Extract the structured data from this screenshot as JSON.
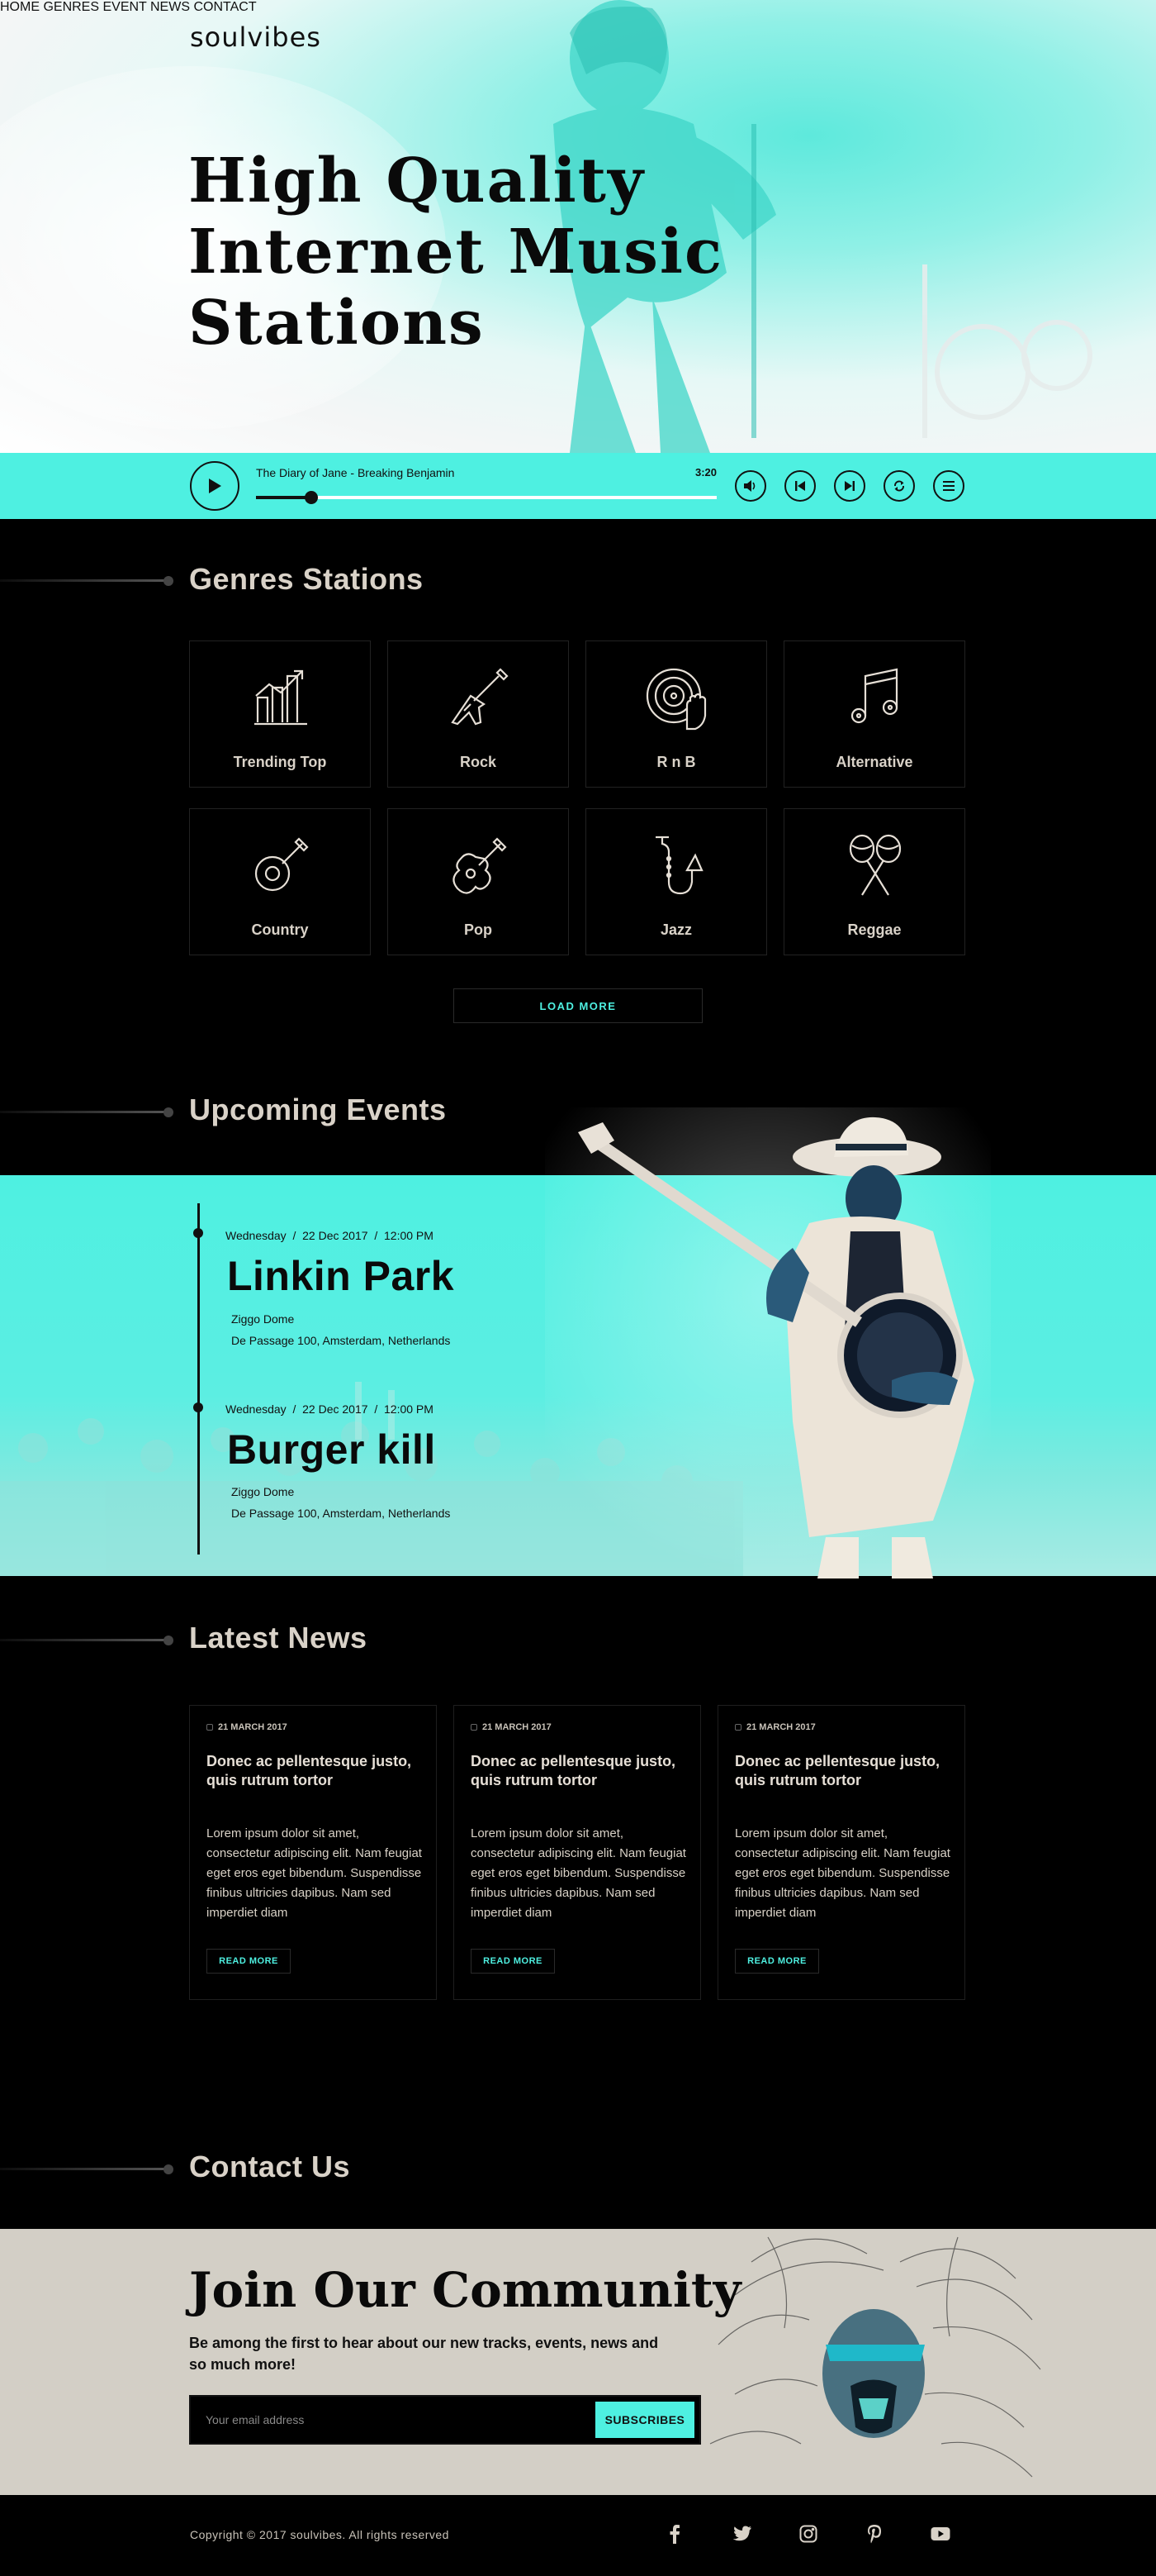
{
  "brand": {
    "logo": "soulvibes"
  },
  "nav": [
    {
      "label": "HOME"
    },
    {
      "label": "GENRES"
    },
    {
      "label": "EVENT"
    },
    {
      "label": "NEWS"
    },
    {
      "label": "CONTACT"
    }
  ],
  "hero": {
    "title_lines": [
      "High Quality",
      "Internet Music",
      "Stations"
    ]
  },
  "player": {
    "track": "The Diary of Jane - Breaking Benjamin",
    "time": "3:20",
    "progress": 0.12,
    "controls": [
      "volume-icon",
      "previous-icon",
      "next-icon",
      "repeat-icon",
      "playlist-icon"
    ],
    "accent": "#4ef0e1"
  },
  "genres": {
    "title": "Genres Stations",
    "items": [
      {
        "label": "Trending Top",
        "icon": "chart-icon"
      },
      {
        "label": "Rock",
        "icon": "electric-guitar-icon"
      },
      {
        "label": "R n B",
        "icon": "vinyl-hand-icon"
      },
      {
        "label": "Alternative",
        "icon": "music-note-icon"
      },
      {
        "label": "Country",
        "icon": "banjo-icon"
      },
      {
        "label": "Pop",
        "icon": "acoustic-guitar-icon"
      },
      {
        "label": "Jazz",
        "icon": "saxophone-icon"
      },
      {
        "label": "Reggae",
        "icon": "maracas-icon"
      }
    ],
    "load_more": "LOAD MORE"
  },
  "events": {
    "title": "Upcoming Events",
    "items": [
      {
        "day": "Wednesday",
        "date": "22 Dec 2017",
        "time": "12:00 PM",
        "name": "Linkin Park",
        "venue": "Ziggo Dome",
        "address": "De Passage 100, Amsterdam, Netherlands"
      },
      {
        "day": "Wednesday",
        "date": "22 Dec 2017",
        "time": "12:00 PM",
        "name": "Burger kill",
        "venue": "Ziggo Dome",
        "address": "De Passage 100, Amsterdam, Netherlands"
      }
    ]
  },
  "news": {
    "title": "Latest News",
    "items": [
      {
        "date": "21 MARCH 2017",
        "headline": "Donec ac pellentesque justo, quis rutrum tortor",
        "body": "Lorem ipsum dolor sit amet, consectetur adipiscing elit. Nam feugiat eget eros eget bibendum. Suspendisse finibus ultricies dapibus. Nam sed imperdiet diam",
        "cta": "READ MORE"
      },
      {
        "date": "21 MARCH 2017",
        "headline": "Donec ac pellentesque justo, quis rutrum tortor",
        "body": "Lorem ipsum dolor sit amet, consectetur adipiscing elit. Nam feugiat eget eros eget bibendum. Suspendisse finibus ultricies dapibus. Nam sed imperdiet diam",
        "cta": "READ MORE"
      },
      {
        "date": "21 MARCH 2017",
        "headline": "Donec ac pellentesque justo, quis rutrum tortor",
        "body": "Lorem ipsum dolor sit amet, consectetur adipiscing elit. Nam feugiat eget eros eget bibendum. Suspendisse finibus ultricies dapibus. Nam sed imperdiet diam",
        "cta": "READ MORE"
      }
    ]
  },
  "contact": {
    "title": "Contact Us",
    "community_title": "Join Our Community",
    "community_sub": "Be among the first to hear about our new tracks, events, news and so much more!",
    "email_placeholder": "Your email address",
    "subscribe": "SUBSCRIBES"
  },
  "footer": {
    "copyright": "Copyright © 2017 soulvibes.  All rights reserved",
    "social": [
      "facebook-icon",
      "twitter-icon",
      "instagram-icon",
      "pinterest-icon",
      "youtube-icon"
    ]
  }
}
